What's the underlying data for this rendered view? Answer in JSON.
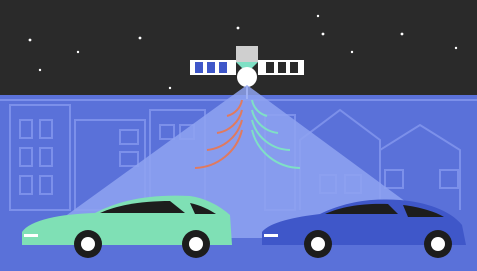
{
  "scene": {
    "sky_color": "#2a2a2a",
    "city_color": "#5a71d9",
    "line_color": "#7c90ea",
    "beam_color": "#8fa3f1",
    "signal_left_color": "#e07a5f",
    "signal_right_color": "#7fe0c5",
    "car_left_color": "#7fe0b5",
    "car_right_color": "#3f57c9"
  },
  "icons": [
    "moon-icon",
    "satellite-icon",
    "signal-waves-icon",
    "car-icon"
  ]
}
